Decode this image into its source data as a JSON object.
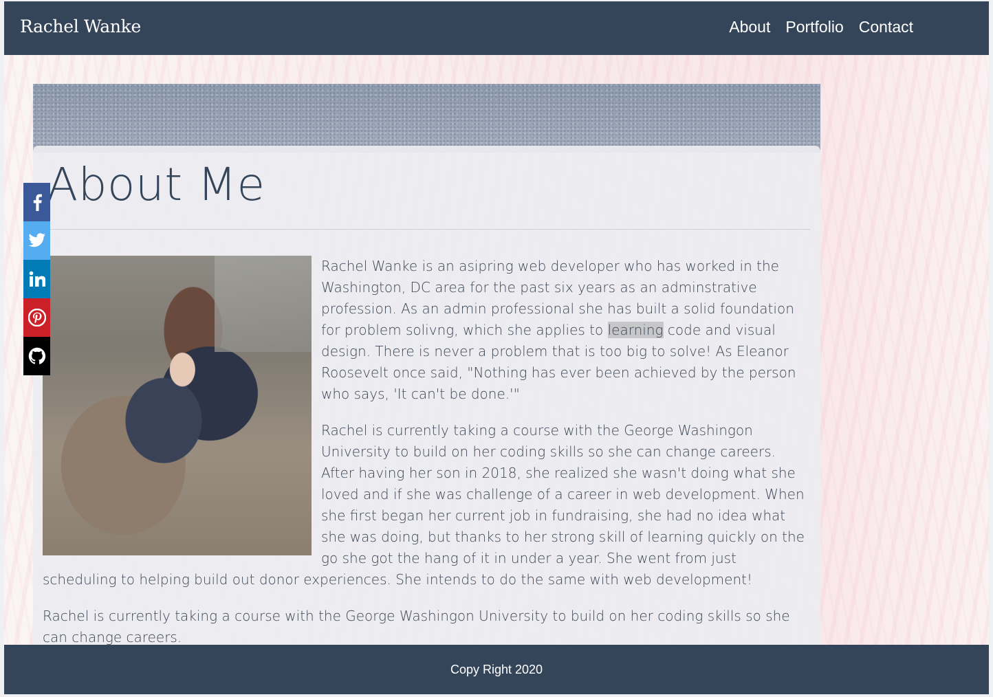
{
  "header": {
    "brand": "Rachel Wanke",
    "nav": [
      "About",
      "Portfolio",
      "Contact"
    ]
  },
  "main": {
    "title": "About Me",
    "paragraphs": [
      {
        "before": "Rachel Wanke is an asipring web developer who has worked in the Washington, DC area for the past six years as an adminstrative profession. As an admin professional she has built a solid foundation for problem solivng, which she applies to ",
        "highlight": "learning",
        "after": " code and visual design. There is never a problem that is too big to solve! As Eleanor Roosevelt once said, \"Nothing has ever been achieved by the person who says, 'It can't be done.'\""
      },
      {
        "text": "Rachel is currently taking a course with the George Washingon University to build on her coding skills so she can change careers. After having her son in 2018, she realized she wasn't doing what she loved and if she was challenge of a career in web development. When she first began her current job in fundraising, she had no idea what she was doing, but thanks to her strong skill of learning quickly on the go she got the hang of it in under a year. She went from just scheduling to helping build out donor experiences. She intends to do the same with web development!"
      },
      {
        "text": "Rachel is currently taking a course with the George Washingon University to build on her coding skills so she can change careers."
      }
    ]
  },
  "social": [
    {
      "name": "facebook",
      "icon": "facebook-icon",
      "color": "#3b5998"
    },
    {
      "name": "twitter",
      "icon": "twitter-icon",
      "color": "#55acee"
    },
    {
      "name": "linkedin",
      "icon": "linkedin-icon",
      "color": "#007bb5"
    },
    {
      "name": "pinterest",
      "icon": "pinterest-icon",
      "color": "#cb2027"
    },
    {
      "name": "github",
      "icon": "github-icon",
      "color": "#000000"
    }
  ],
  "footer": {
    "copyright": "Copy Right 2020"
  },
  "colors": {
    "navbar": "#344559",
    "title": "#344559",
    "highlight": "#c7c7c9"
  }
}
